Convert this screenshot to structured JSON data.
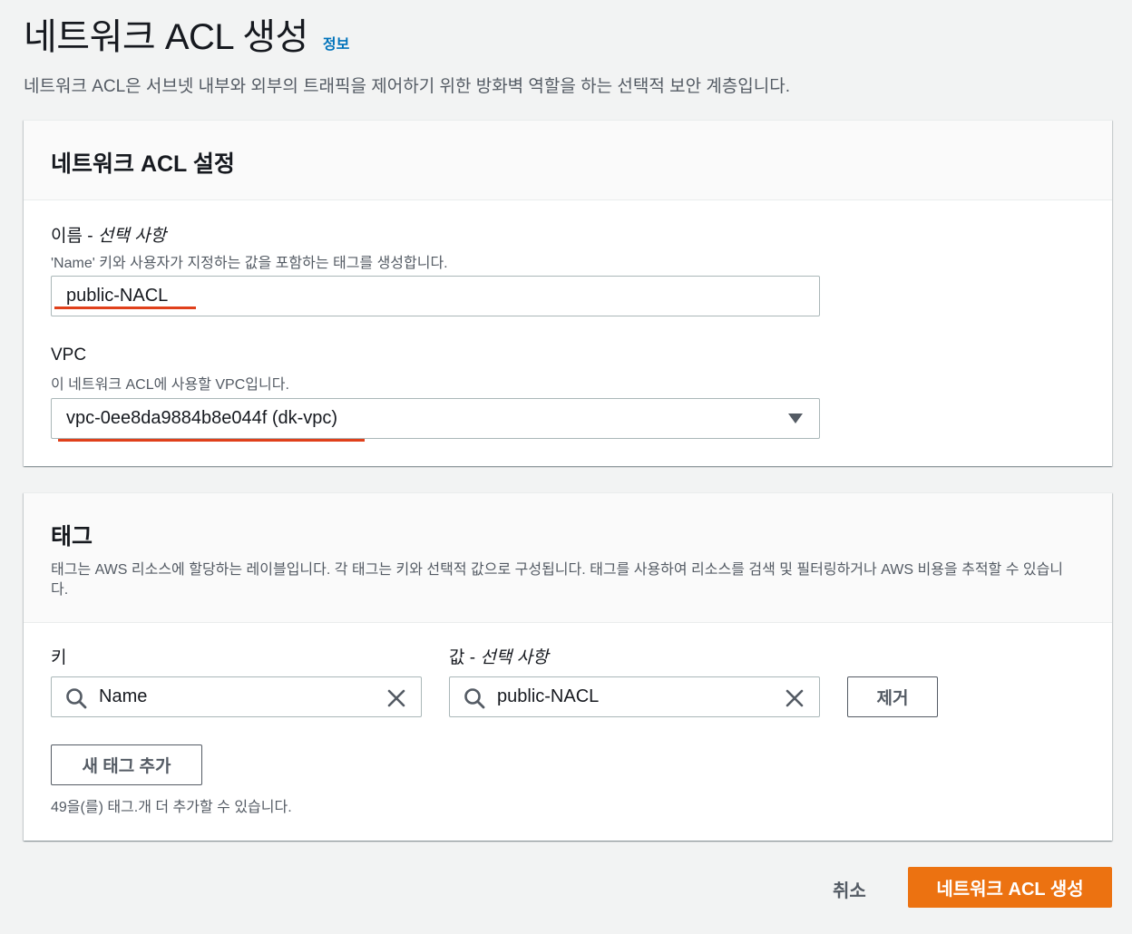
{
  "header": {
    "title": "네트워크 ACL 생성",
    "info_link": "정보",
    "description": "네트워크 ACL은 서브넷 내부와 외부의 트래픽을 제어하기 위한 방화벽 역할을 하는 선택적 보안 계층입니다."
  },
  "settings": {
    "title": "네트워크 ACL 설정",
    "name_label": "이름 - ",
    "name_label_optional": "선택 사항",
    "name_desc": "'Name' 키와 사용자가 지정하는 값을 포함하는 태그를 생성합니다.",
    "name_value": "public-NACL",
    "vpc_label": "VPC",
    "vpc_desc": "이 네트워크 ACL에 사용할 VPC입니다.",
    "vpc_value": "vpc-0ee8da9884b8e044f (dk-vpc)"
  },
  "tags": {
    "title": "태그",
    "description": "태그는 AWS 리소스에 할당하는 레이블입니다. 각 태그는 키와 선택적 값으로 구성됩니다. 태그를 사용하여 리소스를 검색 및 필터링하거나 AWS 비용을 추적할 수 있습니다.",
    "key_label": "키",
    "value_label": "값 - ",
    "value_label_optional": "선택 사항",
    "rows": [
      {
        "key": "Name",
        "value": "public-NACL",
        "remove_label": "제거"
      }
    ],
    "add_tag_label": "새 태그 추가",
    "remaining_text": "49을(를) 태그.개 더 추가할 수 있습니다."
  },
  "footer": {
    "cancel_label": "취소",
    "create_label": "네트워크 ACL 생성"
  },
  "colors": {
    "primary": "#ec7211",
    "link": "#0073bb",
    "underline": "#e0401b"
  }
}
